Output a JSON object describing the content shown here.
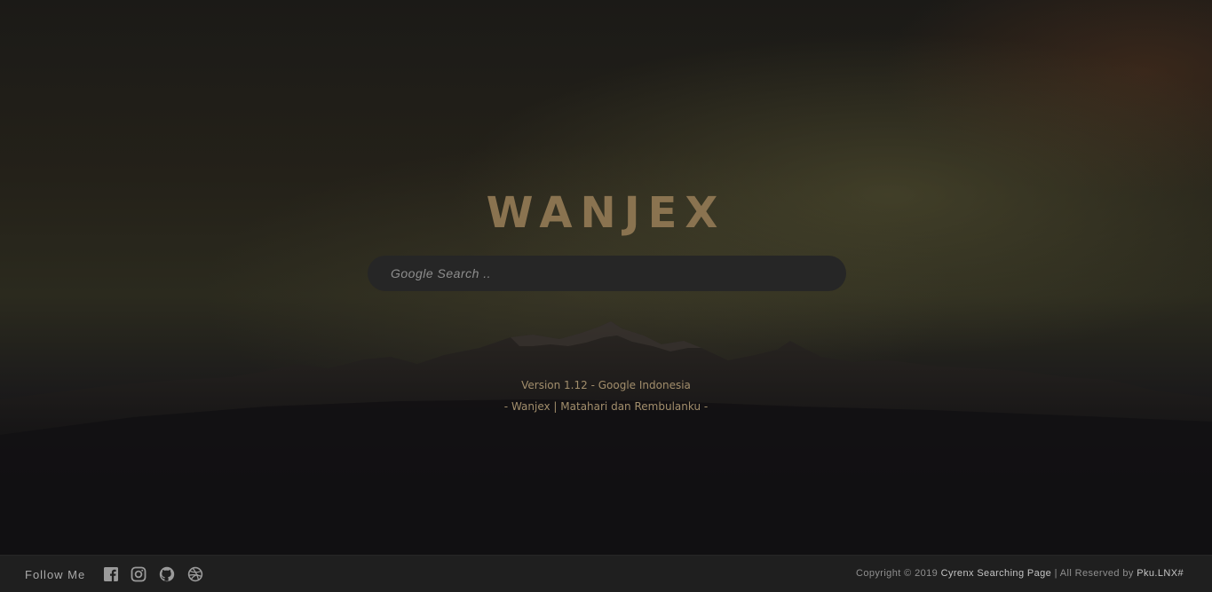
{
  "brand": {
    "title": "WANJEX"
  },
  "search": {
    "placeholder": "Google Search ..",
    "value": ""
  },
  "info": {
    "version": "Version 1.12 - Google Indonesia",
    "tagline": "- Wanjex | Matahari dan Rembulanku -"
  },
  "footer": {
    "follow_label": "Follow Me",
    "social_icons": [
      "facebook-icon",
      "instagram-icon",
      "github-icon",
      "dribbble-icon"
    ],
    "copyright_prefix": "Copyright © 2019 ",
    "copyright_site": "Cyrenx Searching Page",
    "copyright_middle": " | All Reserved by ",
    "copyright_author": "Pku.LNX#"
  },
  "colors": {
    "brand": "#8a7350",
    "info_text": "#a28e6c",
    "search_bg": "#262626",
    "footer_bg": "#1f1f1f"
  }
}
